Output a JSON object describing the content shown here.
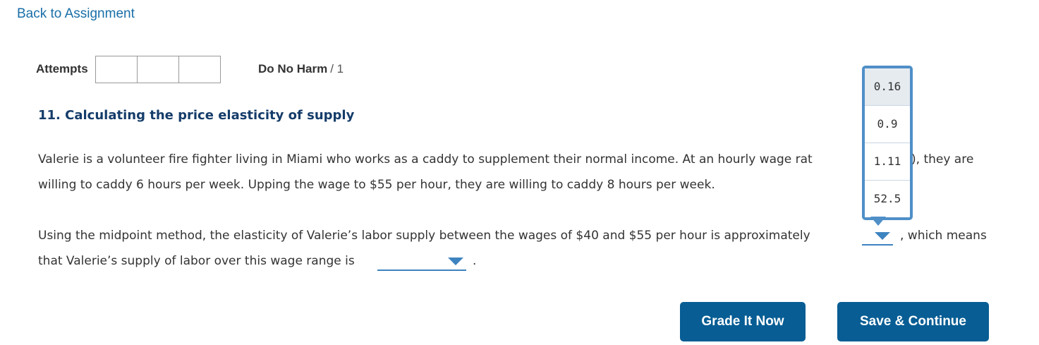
{
  "nav": {
    "back_label": "Back to Assignment"
  },
  "header": {
    "attempts_label": "Attempts",
    "policy_label": "Do No Harm",
    "score_text": "/ 1"
  },
  "question": {
    "title": "11. Calculating the price elasticity of supply",
    "para1_line1_start": "Valerie is a volunteer fire fighter living in Miami who works as a caddy to supplement their normal income. At an hourly wage rat",
    "para1_line1_end": "), they are",
    "para1_line2": "willing to caddy 6 hours per week. Upping the wage to $55 per hour, they are willing to caddy 8 hours per week.",
    "para2_line1": "Using the midpoint method, the elasticity of Valerie’s labor supply between the wages of $40 and $55 per hour is approximately",
    "para2_after_dropdown": ", which means",
    "para2_line2": "that Valerie’s supply of labor over this wage range is",
    "period": "."
  },
  "elasticity_dropdown": {
    "options": [
      "0.16",
      "0.9",
      "1.11",
      "52.5"
    ],
    "highlighted_index": 0
  },
  "buttons": {
    "grade": "Grade It Now",
    "save": "Save & Continue"
  },
  "colors": {
    "link": "#1a6fa8",
    "title": "#153c6a",
    "button_bg": "#075d94",
    "dropdown_accent": "#4f8fc8"
  }
}
